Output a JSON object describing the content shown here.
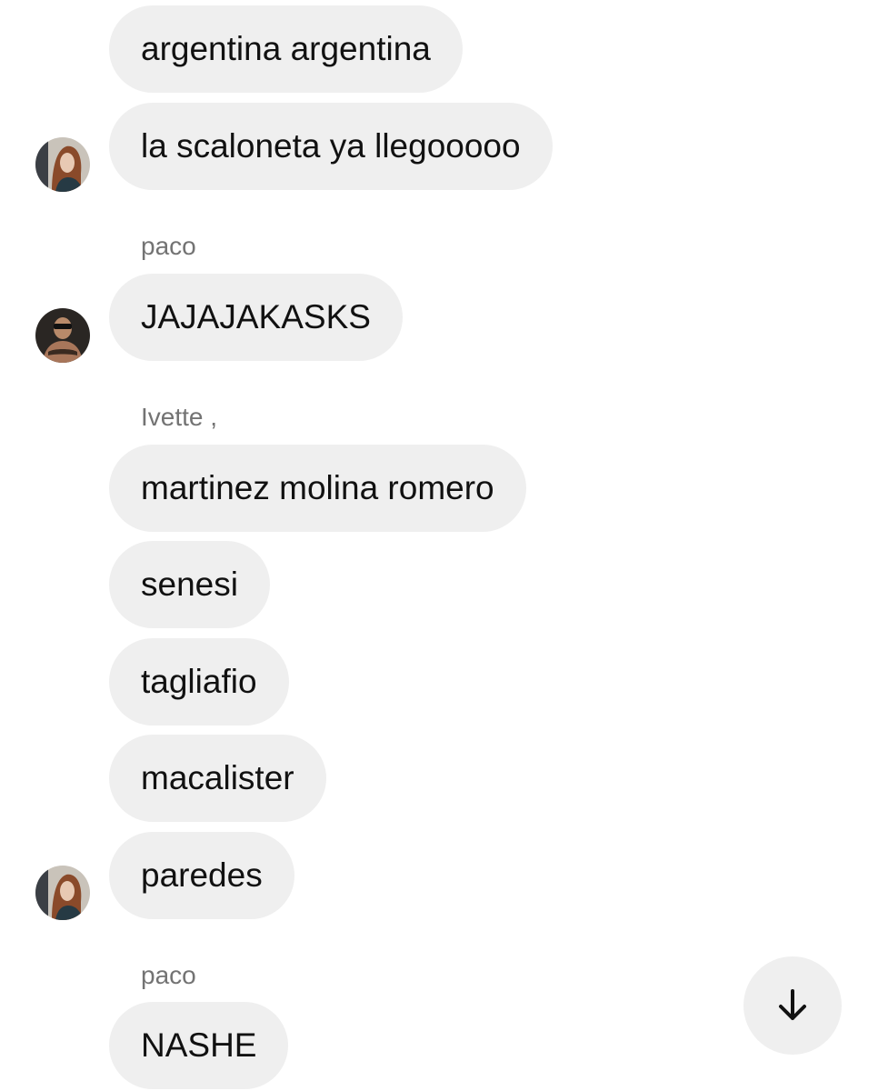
{
  "messages": [
    {
      "text": "argentina argentina"
    },
    {
      "text": "la scaloneta ya llegooooo"
    },
    {
      "sender": "paco",
      "text": "JAJAJAKASKS"
    },
    {
      "sender": "Ivette ,",
      "text": "martinez molina romero"
    },
    {
      "text": "senesi"
    },
    {
      "text": "tagliafio"
    },
    {
      "text": "macalister"
    },
    {
      "text": "paredes"
    },
    {
      "sender": "paco",
      "text": "NASHE"
    }
  ],
  "icons": {
    "scroll_down": "arrow-down-icon",
    "avatar": "user-avatar"
  },
  "colors": {
    "bubble": "#efefef",
    "sender_name": "#737373",
    "text": "#111111",
    "background": "#ffffff"
  }
}
